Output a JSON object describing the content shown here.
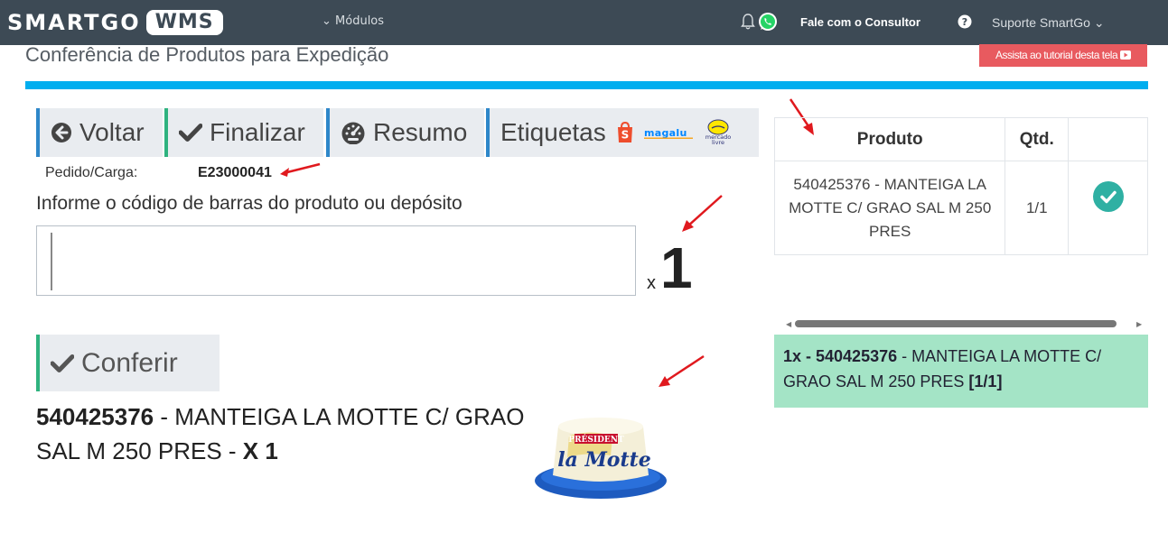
{
  "header": {
    "logo_smart": "SMARTGO",
    "logo_wms": "WMS",
    "modules_label": "Módulos",
    "consultant_label": "Fale com o Consultor",
    "support_label": "Suporte SmartGo"
  },
  "page": {
    "title": "Conferência de Produtos para Expedição",
    "tutorial_label": "Assista ao tutorial desta tela"
  },
  "toolbar": {
    "back_label": "Voltar",
    "finish_label": "Finalizar",
    "summary_label": "Resumo",
    "labels_label": "Etiquetas",
    "marketplaces": [
      "Shopee",
      "Magalu",
      "Mercado Livre"
    ]
  },
  "order": {
    "label": "Pedido/Carga:",
    "value": "E23000041"
  },
  "scan": {
    "instruction": "Informe o código de barras do produto ou depósito",
    "input_value": "",
    "multiplier_prefix": "x",
    "multiplier_value": "1"
  },
  "confirm": {
    "button_label": "Conferir",
    "product_code": "540425376",
    "product_name": " - MANTEIGA LA MOTTE C/ GRAO SAL M 250 PRES - ",
    "product_qty": "X 1",
    "image_text": "PRÉSIDENT la Motte"
  },
  "product_table": {
    "headers": [
      "Produto",
      "Qtd.",
      ""
    ],
    "rows": [
      {
        "product": "540425376 - MANTEIGA LA MOTTE C/ GRAO SAL M 250 PRES",
        "qty": "1/1",
        "status": "checked"
      }
    ]
  },
  "result": {
    "prefix": "1x - 540425376",
    "text": " - MANTEIGA LA MOTTE C/ GRAO SAL M 250 PRES ",
    "qty": "[1/1]"
  },
  "colors": {
    "topbar": "#3d4a55",
    "accent_blue": "#00aeef",
    "success": "#2fb0a3",
    "result_bg": "#a4e4c6",
    "tutorial_red": "#e85a5f",
    "annotation_red": "#e0191e"
  }
}
